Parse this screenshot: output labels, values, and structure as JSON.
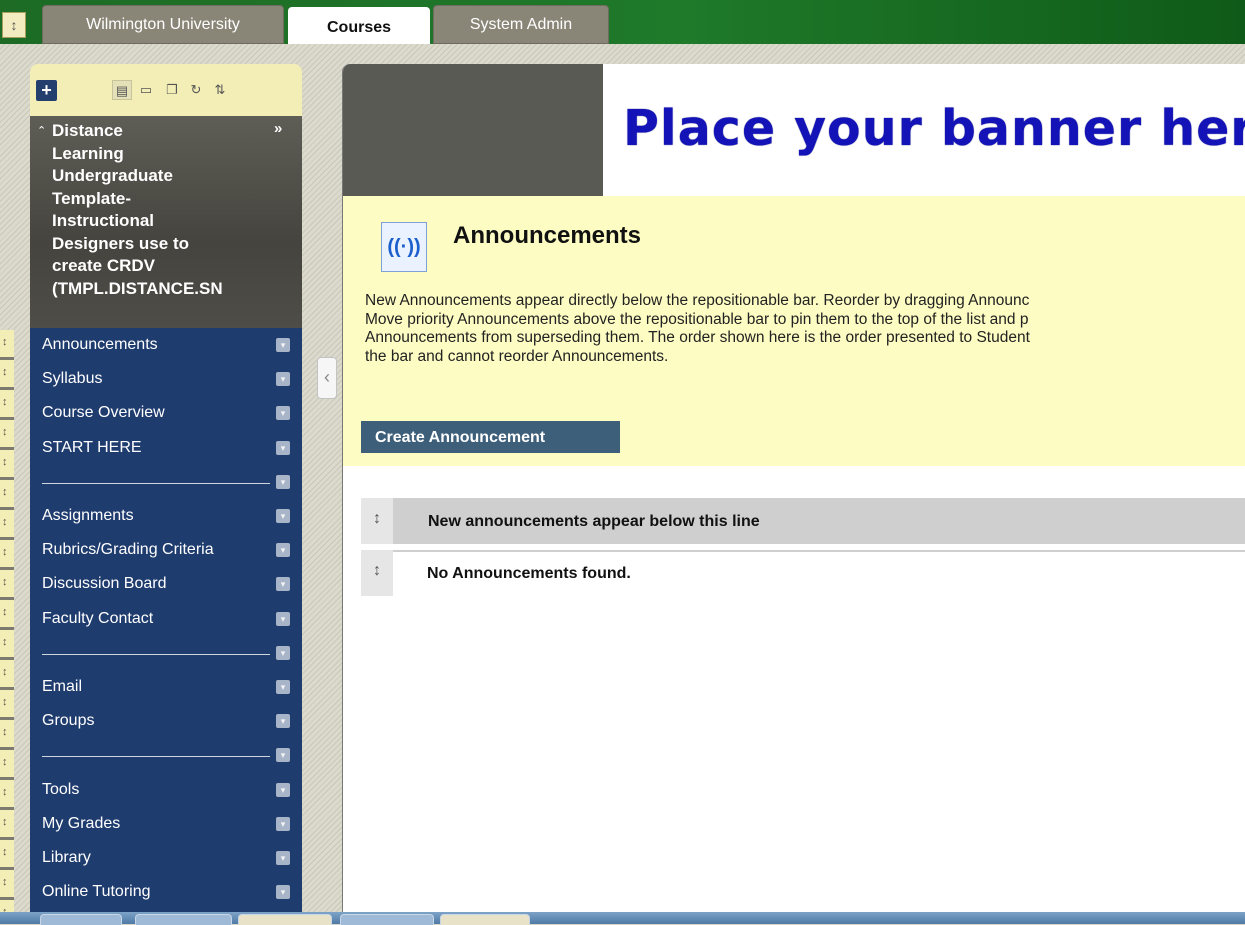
{
  "tabs": [
    {
      "label": "Wilmington University",
      "active": false
    },
    {
      "label": "Courses",
      "active": true
    },
    {
      "label": "System Admin",
      "active": false
    }
  ],
  "menu_toggle_glyph": "↕",
  "sidebar": {
    "add_glyph": "+",
    "course_title": "Distance\nLearning\nUndergraduate\nTemplate-\nInstructional\nDesigners use to\ncreate CRDV\n(TMPL.DISTANCE.SN",
    "items": [
      {
        "type": "link",
        "label": "Announcements"
      },
      {
        "type": "link",
        "label": "Syllabus"
      },
      {
        "type": "link",
        "label": "Course Overview"
      },
      {
        "type": "link",
        "label": "START HERE"
      },
      {
        "type": "divider",
        "label": ""
      },
      {
        "type": "link",
        "label": "Assignments"
      },
      {
        "type": "link",
        "label": "Rubrics/Grading Criteria"
      },
      {
        "type": "link",
        "label": "Discussion Board"
      },
      {
        "type": "link",
        "label": "Faculty Contact"
      },
      {
        "type": "divider",
        "label": ""
      },
      {
        "type": "link",
        "label": "Email"
      },
      {
        "type": "link",
        "label": "Groups"
      },
      {
        "type": "divider",
        "label": ""
      },
      {
        "type": "link",
        "label": "Tools"
      },
      {
        "type": "link",
        "label": "My Grades"
      },
      {
        "type": "link",
        "label": "Library"
      },
      {
        "type": "link",
        "label": "Online Tutoring"
      }
    ]
  },
  "main": {
    "banner_text": "Place your banner here",
    "announcements": {
      "title": "Announcements",
      "description": "New Announcements appear directly below the repositionable bar. Reorder by dragging Announc\nMove priority Announcements above the repositionable bar to pin them to the top of the list and p\nAnnouncements from superseding them. The order shown here is the order presented to Student\nthe bar and cannot reorder Announcements.",
      "create_button": "Create Announcement",
      "bar_label": "New announcements appear below this line",
      "empty_label": "No Announcements found."
    }
  },
  "colors": {
    "topbar": "#1f7a2a",
    "nav_bg": "#1f3c6e",
    "panel_bg": "#fdfcc3",
    "banner_text": "#1313b8"
  }
}
